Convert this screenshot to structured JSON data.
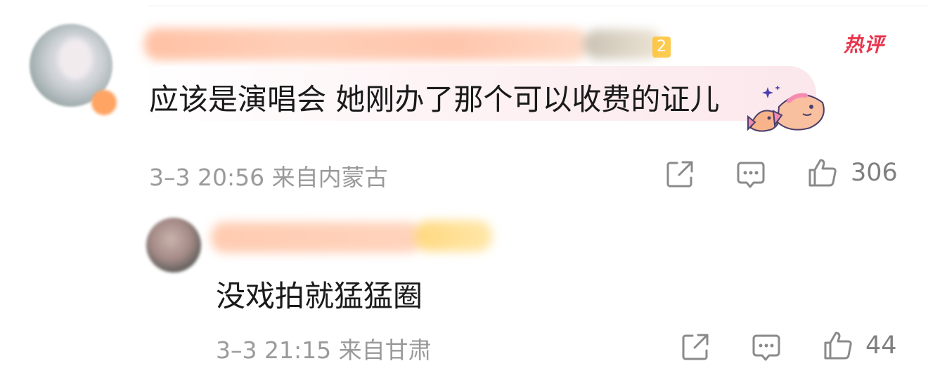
{
  "comments": [
    {
      "text": "应该是演唱会 她刚办了那个可以收费的证儿",
      "level": "2",
      "hot_label": "热评",
      "meta": "3–3 20:56  来自内蒙古",
      "likes": "306",
      "icons": [
        "share-icon",
        "comment-icon",
        "like-icon"
      ]
    },
    {
      "text": "没戏拍就猛猛圈",
      "meta": "3–3 21:15  来自甘肃",
      "likes": "44",
      "icons": [
        "share-icon",
        "comment-icon",
        "like-icon"
      ]
    }
  ],
  "colors": {
    "hot_badge": "#e8344c",
    "meta_text": "#9a9a9a",
    "icon": "#8a8a8a",
    "bubble": "#fbe7ec",
    "level_badge": "#ffc233"
  }
}
